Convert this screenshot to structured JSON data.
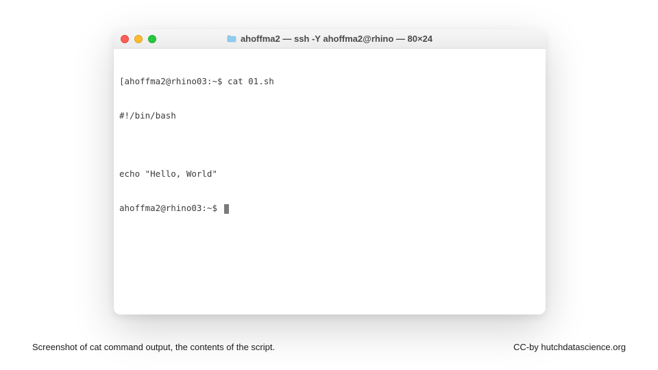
{
  "window": {
    "title": "ahoffma2 — ssh -Y ahoffma2@rhino — 80×24",
    "traffic_lights": {
      "close": "close",
      "minimize": "minimize",
      "maximize": "maximize"
    }
  },
  "terminal": {
    "lines": [
      "[ahoffma2@rhino03:~$ cat 01.sh",
      "#!/bin/bash",
      "",
      "echo \"Hello, World\"",
      "ahoffma2@rhino03:~$ "
    ]
  },
  "caption": "Screenshot of cat command output, the contents of the script.",
  "attribution": "CC-by hutchdatascience.org"
}
